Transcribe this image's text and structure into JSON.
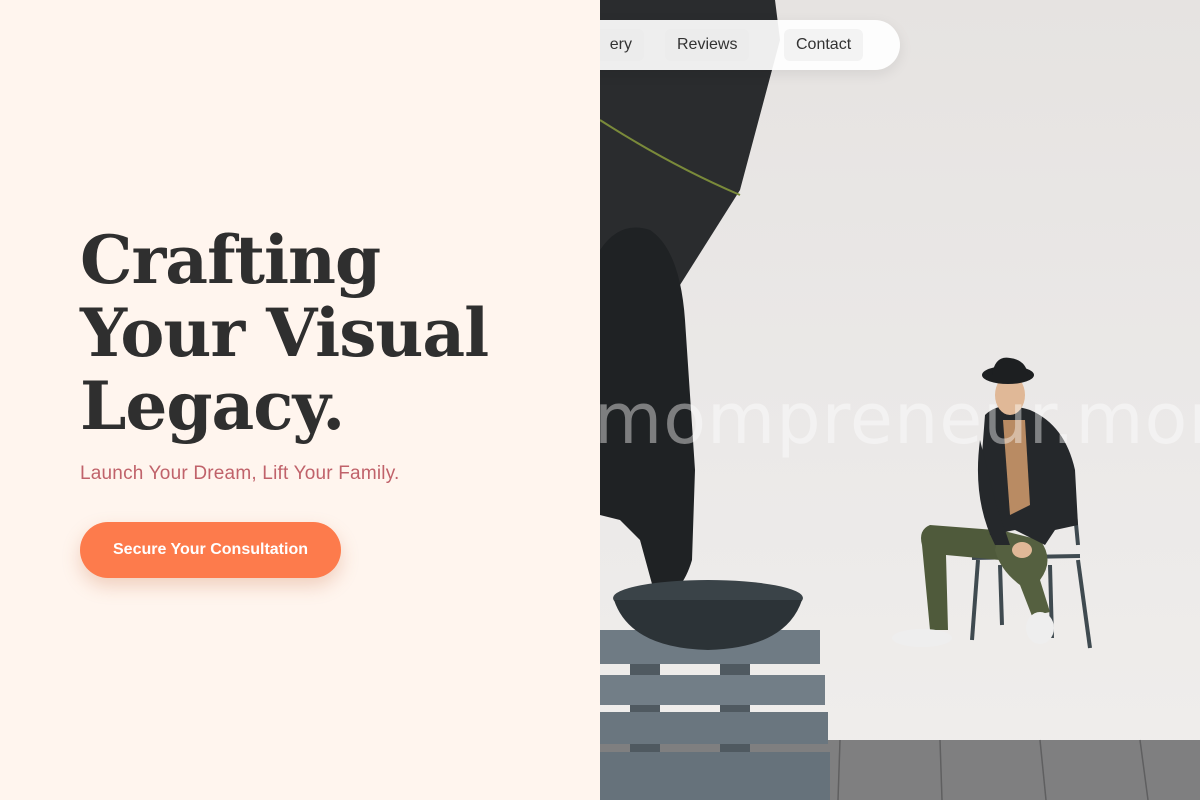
{
  "nav": {
    "items": [
      {
        "label": "Gallery",
        "visible_text": "ery"
      },
      {
        "label": "Reviews"
      },
      {
        "label": "Contact"
      }
    ]
  },
  "hero": {
    "headline_lines": [
      "Crafting",
      "Your Visual",
      "Legacy."
    ],
    "tagline": "Launch Your Dream, Lift Your Family.",
    "cta_label": "Secure Your Consultation"
  },
  "photo": {
    "watermark": "mompreneur.mom"
  },
  "colors": {
    "background": "#fff5ee",
    "headline": "#2f2f2f",
    "tagline": "#c0626a",
    "cta": "#fd7b4c",
    "cta_text": "#ffffff"
  }
}
